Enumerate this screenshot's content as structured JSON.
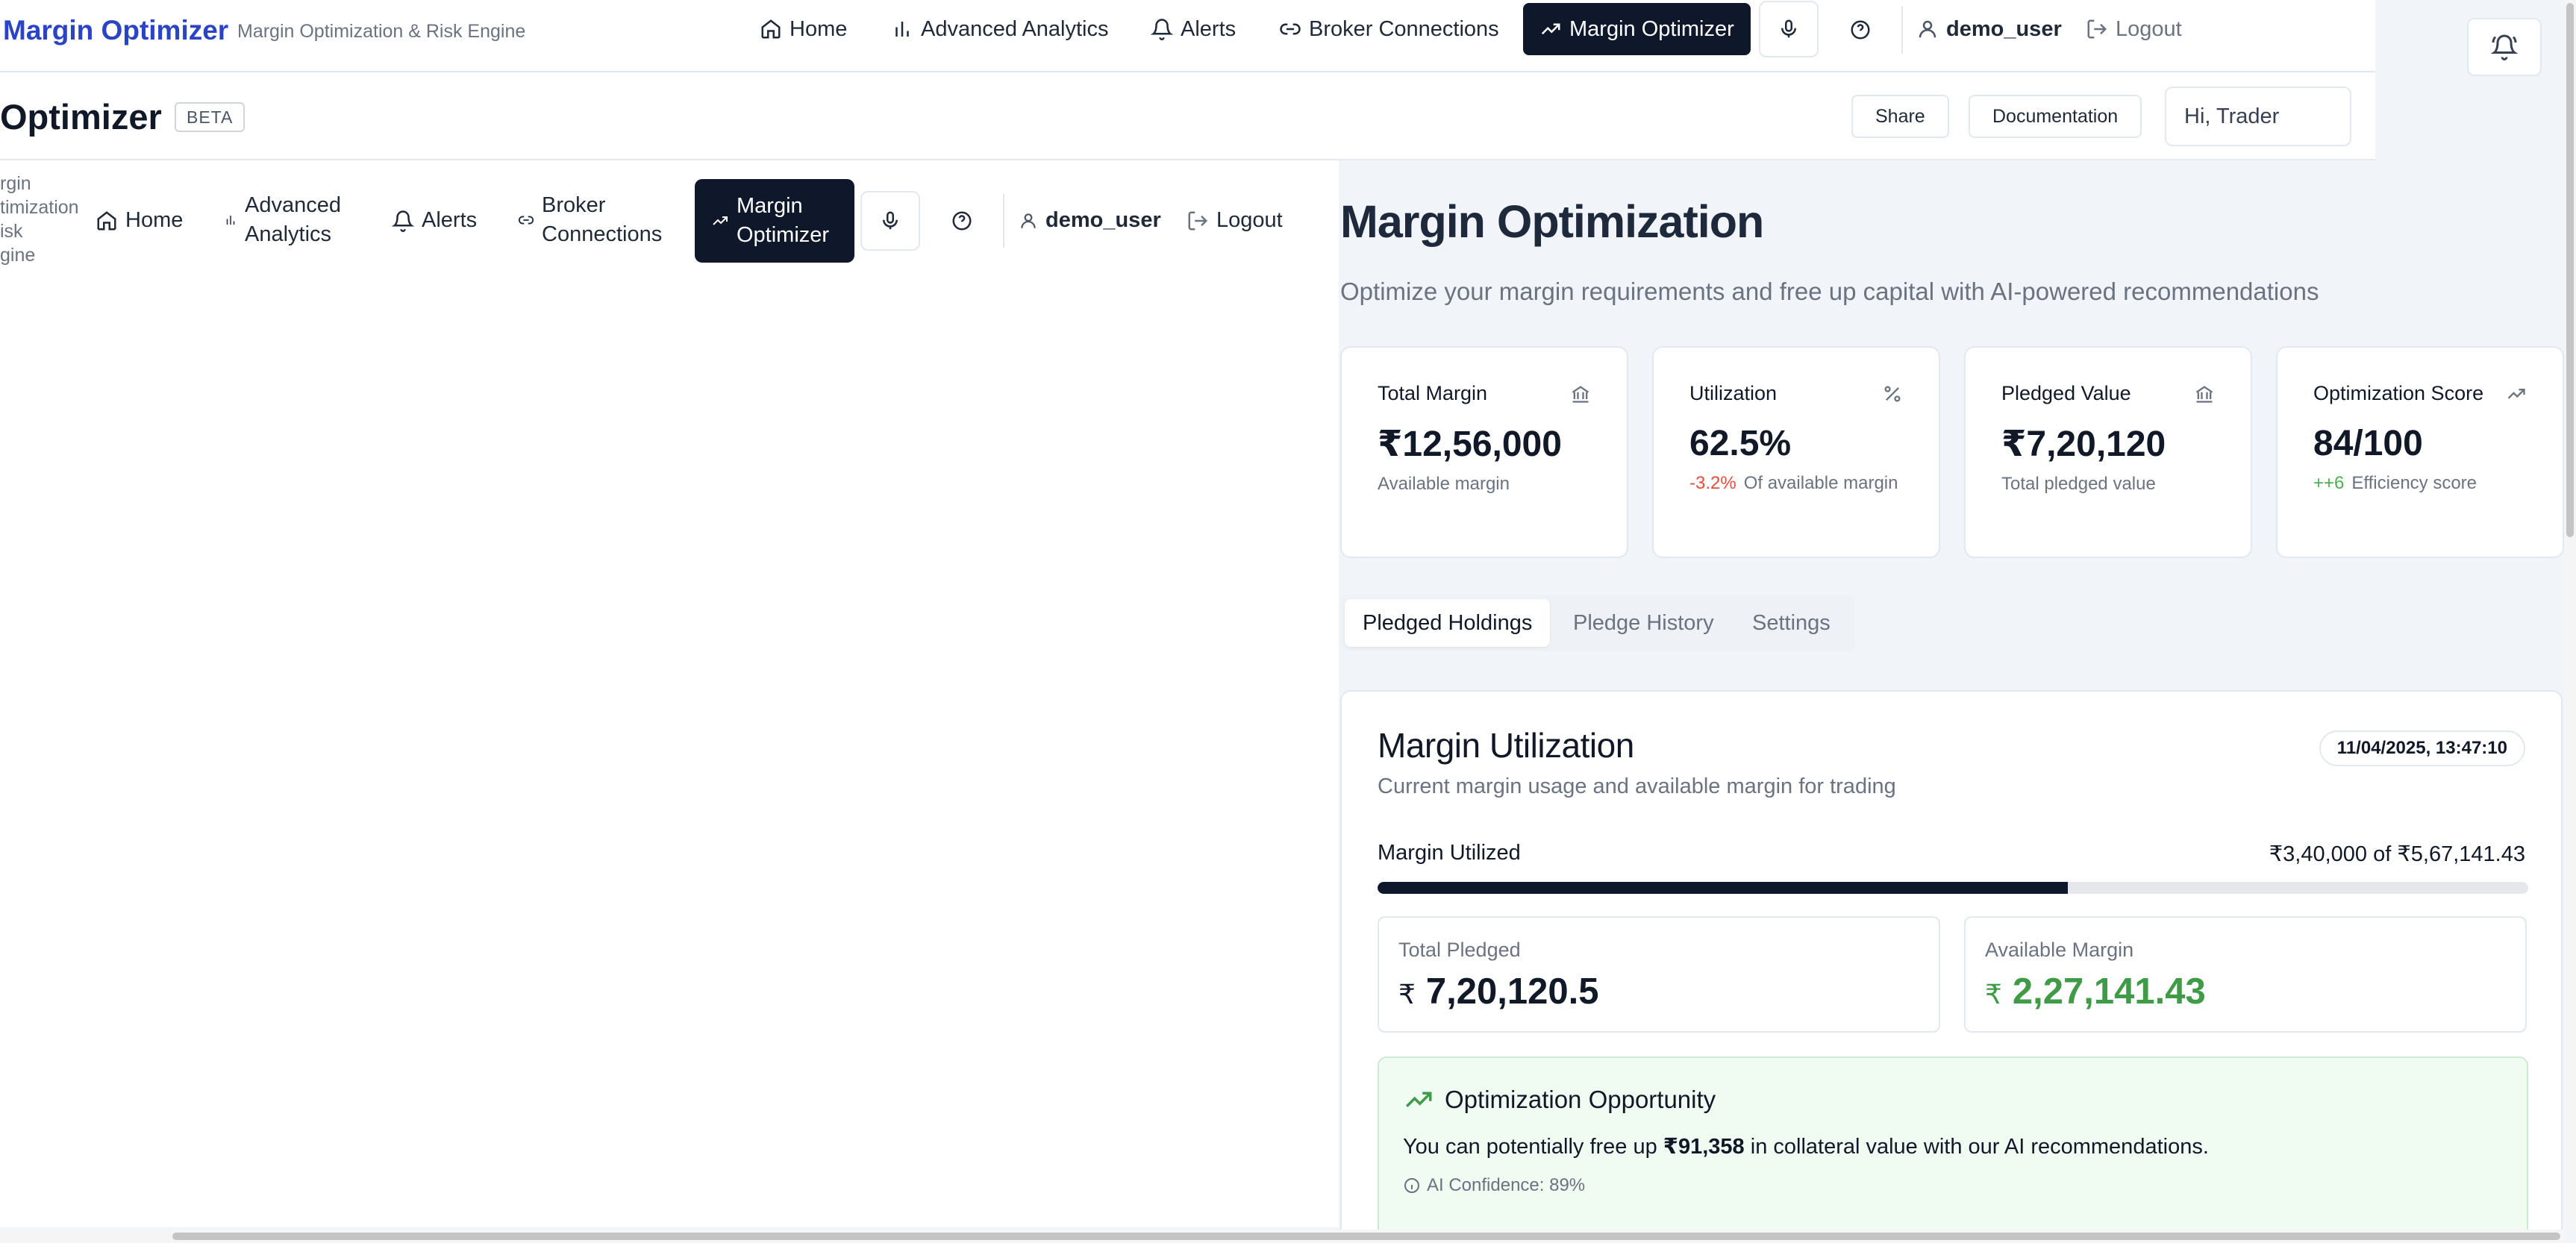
{
  "topnav": {
    "brand": "Margin Optimizer",
    "subtitle": "Margin Optimization & Risk Engine",
    "items": [
      {
        "label": "Home",
        "icon": "home-icon"
      },
      {
        "label": "Advanced Analytics",
        "icon": "bar-chart-icon"
      },
      {
        "label": "Alerts",
        "icon": "bell-icon"
      },
      {
        "label": "Broker Connections",
        "icon": "link-icon"
      },
      {
        "label": "Margin Optimizer",
        "icon": "trending-up-icon",
        "active": true
      }
    ],
    "user": "demo_user",
    "logout": "Logout"
  },
  "pagehead": {
    "title": "Optimizer",
    "badge": "BETA",
    "share": "Share",
    "documentation": "Documentation",
    "greeting": "Hi, Trader"
  },
  "leftpane": {
    "clipped_subtitle": "rgin\ntimization\nisk\ngine",
    "items": [
      {
        "label": "Home"
      },
      {
        "label": "Advanced\nAnalytics"
      },
      {
        "label": "Alerts"
      },
      {
        "label": "Broker\nConnections"
      },
      {
        "label": "Margin\nOptimizer"
      }
    ],
    "user": "demo_user",
    "logout": "Logout"
  },
  "main": {
    "title": "Margin Optimization",
    "subtitle": "Optimize your margin requirements and free up capital with AI-powered recommendations"
  },
  "cards": [
    {
      "title": "Total Margin",
      "icon": "bank-icon",
      "value": "₹12,56,000",
      "delta": "",
      "note": "Available margin"
    },
    {
      "title": "Utilization",
      "icon": "percent-icon",
      "value": "62.5%",
      "delta": "-3.2%",
      "note": "Of available margin"
    },
    {
      "title": "Pledged Value",
      "icon": "bank-icon",
      "value": "₹7,20,120",
      "delta": "",
      "note": "Total pledged value"
    },
    {
      "title": "Optimization Score",
      "icon": "trending-up-icon",
      "value": "84/100",
      "delta": "++6",
      "note": "Efficiency score"
    }
  ],
  "tabs": [
    "Pledged Holdings",
    "Pledge History",
    "Settings"
  ],
  "panel": {
    "title": "Margin Utilization",
    "subtitle": "Current margin usage and available margin for trading",
    "timestamp": "11/04/2025, 13:47:10",
    "utilized_label": "Margin Utilized",
    "utilized_value": "₹3,40,000 of ₹5,67,141.43",
    "utilized_fraction": 0.6,
    "total_pledged_label": "Total Pledged",
    "total_pledged_currency": "₹",
    "total_pledged_value": "7,20,120.5",
    "available_label": "Available Margin",
    "available_currency": "₹",
    "available_value": "2,27,141.43"
  },
  "opportunity": {
    "title": "Optimization Opportunity",
    "text_before": "You can potentially free up ",
    "amount": "₹91,358",
    "text_after": " in collateral value with our AI recommendations.",
    "confidence": "AI Confidence: 89%"
  },
  "colors": {
    "brand": "#2b44c6",
    "active_nav": "#0f172a",
    "negative": "#e74c3c",
    "positive": "#4caf50"
  }
}
